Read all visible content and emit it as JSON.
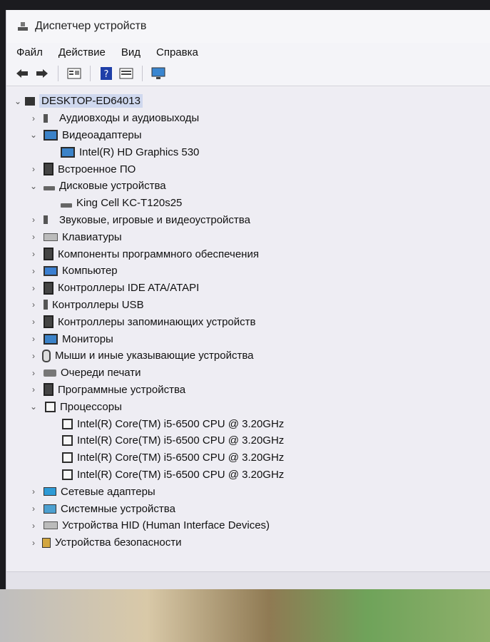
{
  "window": {
    "title": "Диспетчер устройств"
  },
  "menu": [
    "Файл",
    "Действие",
    "Вид",
    "Справка"
  ],
  "toolbar": {
    "icons": [
      "arrow-left-icon",
      "arrow-right-icon",
      "properties-icon",
      "help-icon",
      "view-icon",
      "monitor-scan-icon"
    ]
  },
  "tree": {
    "root": "DESKTOP-ED64013",
    "items": [
      {
        "label": "Аудиовходы и аудиовыходы",
        "level": 1,
        "state": "collapsed",
        "icon": "speaker-icon"
      },
      {
        "label": "Видеоадаптеры",
        "level": 1,
        "state": "expanded",
        "icon": "display-adapter-icon"
      },
      {
        "label": "Intel(R) HD Graphics 530",
        "level": 2,
        "state": "leaf",
        "icon": "display-adapter-icon"
      },
      {
        "label": "Встроенное ПО",
        "level": 1,
        "state": "collapsed",
        "icon": "firmware-icon"
      },
      {
        "label": "Дисковые устройства",
        "level": 1,
        "state": "expanded",
        "icon": "disk-drive-icon"
      },
      {
        "label": "King Cell KC-T120s25",
        "level": 2,
        "state": "leaf",
        "icon": "disk-drive-icon"
      },
      {
        "label": "Звуковые, игровые и видеоустройства",
        "level": 1,
        "state": "collapsed",
        "icon": "speaker-icon"
      },
      {
        "label": "Клавиатуры",
        "level": 1,
        "state": "collapsed",
        "icon": "keyboard-icon"
      },
      {
        "label": "Компоненты программного обеспечения",
        "level": 1,
        "state": "collapsed",
        "icon": "software-component-icon"
      },
      {
        "label": "Компьютер",
        "level": 1,
        "state": "collapsed",
        "icon": "computer-icon"
      },
      {
        "label": "Контроллеры IDE ATA/ATAPI",
        "level": 1,
        "state": "collapsed",
        "icon": "ide-controller-icon"
      },
      {
        "label": "Контроллеры USB",
        "level": 1,
        "state": "collapsed",
        "icon": "usb-icon"
      },
      {
        "label": "Контроллеры запоминающих устройств",
        "level": 1,
        "state": "collapsed",
        "icon": "storage-controller-icon"
      },
      {
        "label": "Мониторы",
        "level": 1,
        "state": "collapsed",
        "icon": "monitor-icon"
      },
      {
        "label": "Мыши и иные указывающие устройства",
        "level": 1,
        "state": "collapsed",
        "icon": "mouse-icon"
      },
      {
        "label": "Очереди печати",
        "level": 1,
        "state": "collapsed",
        "icon": "printer-icon"
      },
      {
        "label": "Программные устройства",
        "level": 1,
        "state": "collapsed",
        "icon": "software-device-icon"
      },
      {
        "label": "Процессоры",
        "level": 1,
        "state": "expanded",
        "icon": "processor-icon"
      },
      {
        "label": "Intel(R) Core(TM) i5-6500 CPU @ 3.20GHz",
        "level": 2,
        "state": "leaf",
        "icon": "processor-icon"
      },
      {
        "label": "Intel(R) Core(TM) i5-6500 CPU @ 3.20GHz",
        "level": 2,
        "state": "leaf",
        "icon": "processor-icon"
      },
      {
        "label": "Intel(R) Core(TM) i5-6500 CPU @ 3.20GHz",
        "level": 2,
        "state": "leaf",
        "icon": "processor-icon"
      },
      {
        "label": "Intel(R) Core(TM) i5-6500 CPU @ 3.20GHz",
        "level": 2,
        "state": "leaf",
        "icon": "processor-icon"
      },
      {
        "label": "Сетевые адаптеры",
        "level": 1,
        "state": "collapsed",
        "icon": "network-adapter-icon"
      },
      {
        "label": "Системные устройства",
        "level": 1,
        "state": "collapsed",
        "icon": "system-device-icon"
      },
      {
        "label": "Устройства HID (Human Interface Devices)",
        "level": 1,
        "state": "collapsed",
        "icon": "hid-icon"
      },
      {
        "label": "Устройства безопасности",
        "level": 1,
        "state": "collapsed",
        "icon": "security-device-icon"
      }
    ]
  }
}
